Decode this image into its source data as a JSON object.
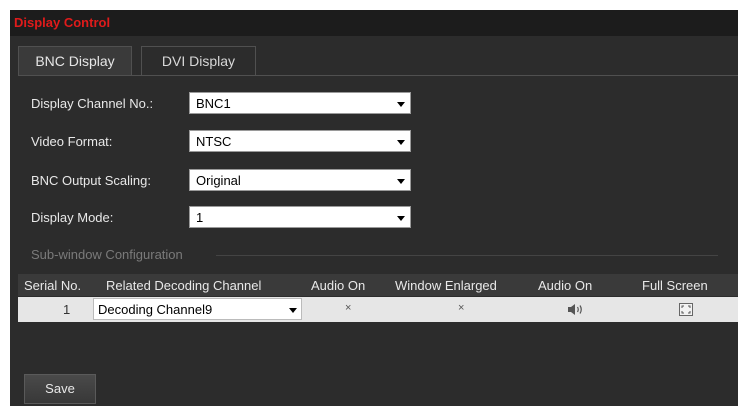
{
  "window": {
    "title": "Display Control"
  },
  "tabs": [
    {
      "label": "BNC Display",
      "active": true
    },
    {
      "label": "DVI Display",
      "active": false
    }
  ],
  "form": {
    "display_channel": {
      "label": "Display Channel No.:",
      "value": "BNC1"
    },
    "video_format": {
      "label": "Video Format:",
      "value": "NTSC"
    },
    "output_scaling": {
      "label": "BNC Output Scaling:",
      "value": "Original"
    },
    "display_mode": {
      "label": "Display Mode:",
      "value": "1"
    }
  },
  "subwindow": {
    "title": "Sub-window Configuration",
    "columns": [
      "Serial No.",
      "Related Decoding Channel",
      "Audio On",
      "Window Enlarged",
      "Audio On",
      "Full Screen"
    ],
    "rows": [
      {
        "serial": "1",
        "channel": "Decoding Channel9",
        "audio_on": "×",
        "window_enlarged": "×",
        "audio_icon": "speaker-icon",
        "full_screen_icon": "fullscreen-icon"
      }
    ]
  },
  "actions": {
    "save_label": "Save"
  },
  "colors": {
    "title_red": "#e01b1b",
    "panel_bg": "#2c2c2c",
    "row_bg": "#e6e6e6"
  }
}
